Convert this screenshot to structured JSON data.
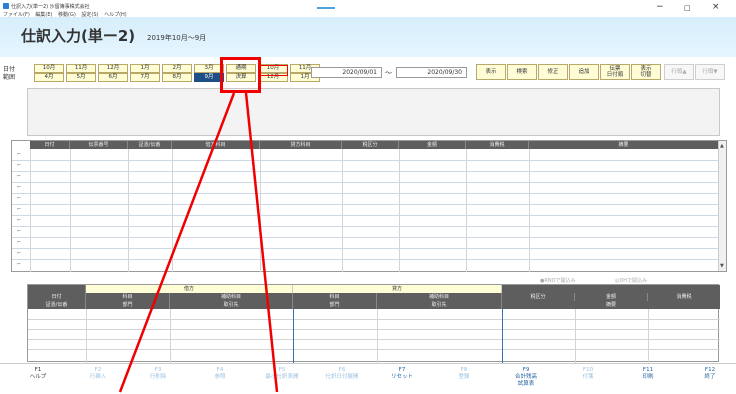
{
  "window": {
    "title": "仕訳入力(単一2) 沙留簿事株式会社",
    "menu": [
      "ファイル(F)",
      "編集(E)",
      "移動(G)",
      "設定(S)",
      "ヘルプ(H)"
    ],
    "minimize": "−",
    "maximize": "□",
    "close": "×"
  },
  "header": {
    "title": "仕訳入力(単ー2)",
    "fiscal_period": "2019年10月～9月"
  },
  "range": {
    "label1": "日付",
    "label2": "範囲"
  },
  "months": {
    "row1": [
      "10月",
      "11月",
      "12月",
      "1月",
      "2月",
      "3月",
      "通期",
      "10月",
      "11月"
    ],
    "row2": [
      "4月",
      "5月",
      "6月",
      "7月",
      "8月",
      "9月",
      "決算",
      "12月",
      "1月"
    ]
  },
  "dates": {
    "from": "2020/09/01",
    "tilde": "～",
    "to": "2020/09/30"
  },
  "actions": [
    "表示",
    "検索",
    "修正",
    "追加"
  ],
  "sort_button": [
    "伝票",
    "日付順"
  ],
  "display_switch": [
    "表示",
    "切替"
  ],
  "nav_prev": "行頭▲",
  "nav_next": "行頭▼",
  "grid": {
    "columns": [
      "日付",
      "伝票番号",
      "証憑/伝番",
      "借方科目",
      "貸方科目",
      "税区分",
      "金額",
      "消費税",
      "摘要"
    ]
  },
  "radios": [
    "●RNOで開込み",
    "◎DHで開込み"
  ],
  "detail": {
    "debit_header": "借方",
    "credit_header": "貸方",
    "row1": [
      "日付",
      "科目",
      "補助科目",
      "科目",
      "補助科目",
      "税区分",
      "金額",
      "消費税"
    ],
    "row2": [
      "証憑/伝番",
      "部門",
      "取引先",
      "部門",
      "取引先",
      "摘要"
    ]
  },
  "fkeys": [
    {
      "key": "F1",
      "label": "ヘルプ"
    },
    {
      "key": "F2",
      "label": "行挿入"
    },
    {
      "key": "F3",
      "label": "行削除"
    },
    {
      "key": "F4",
      "label": "参照"
    },
    {
      "key": "F5",
      "label": "最小仕訳表開"
    },
    {
      "key": "F6",
      "label": "仕訳日付展開"
    },
    {
      "key": "F7",
      "label": "リセット"
    },
    {
      "key": "F8",
      "label": "登録"
    },
    {
      "key": "F9",
      "label": "合計残高\n試算表"
    },
    {
      "key": "F10",
      "label": "付箋"
    },
    {
      "key": "F11",
      "label": "印刷"
    },
    {
      "key": "F12",
      "label": "終了"
    }
  ],
  "colors": {
    "header_bg": "#d6eefc",
    "selected_month": "#1d4f86",
    "button_bg": "#fffdd5",
    "callout": "#f00000"
  }
}
